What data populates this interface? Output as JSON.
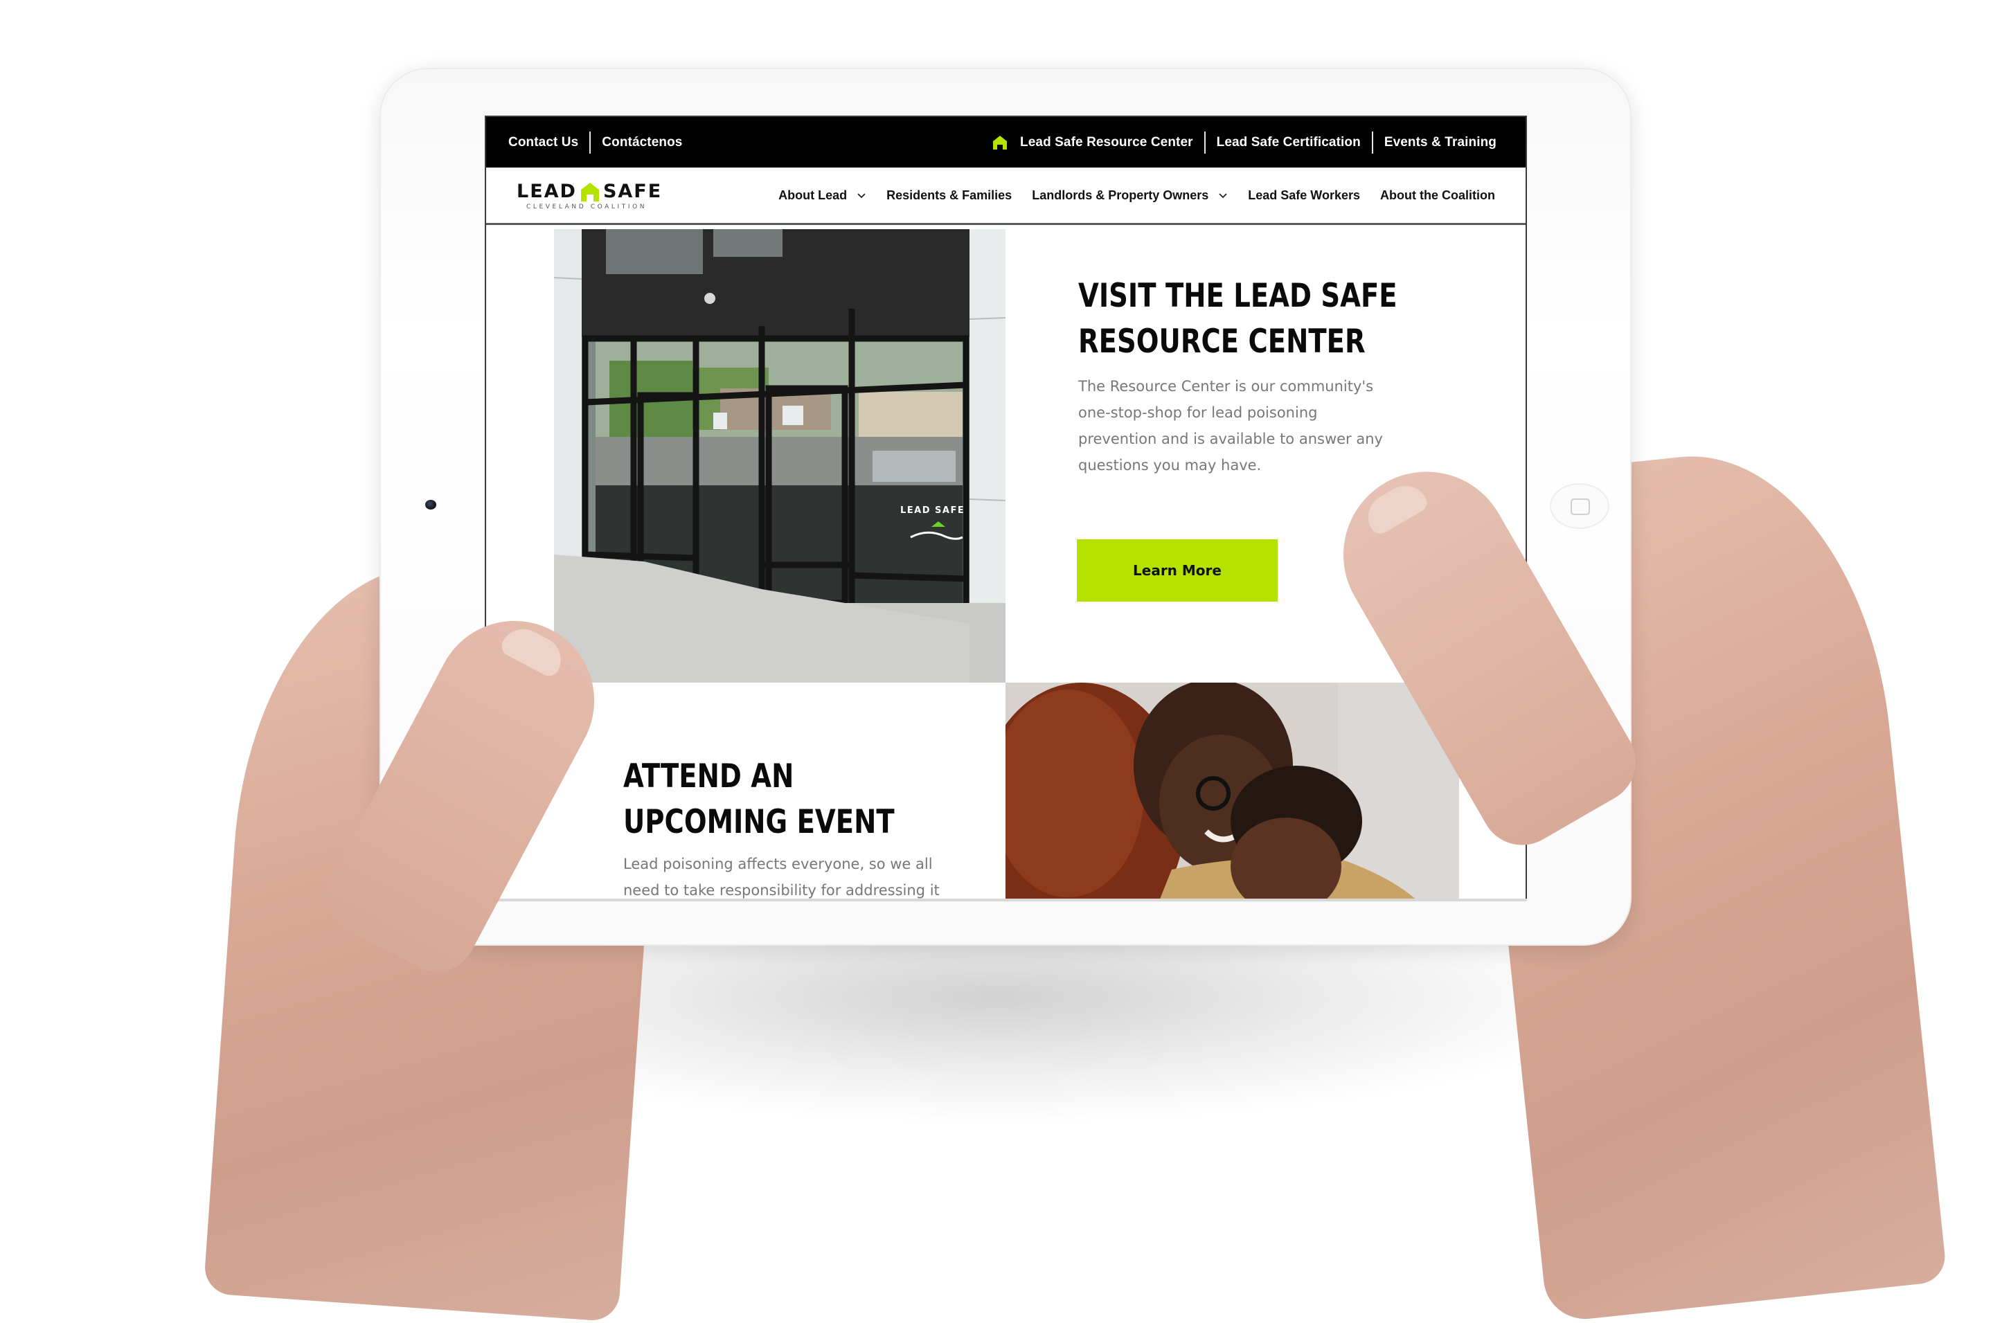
{
  "device": {
    "type": "tablet",
    "camera_icon": "camera-icon",
    "home_button_icon": "home-button-icon"
  },
  "colors": {
    "accent": "#b6e200",
    "topbar_bg": "#000000",
    "heading": "#0a0a0a",
    "body_text": "#777777"
  },
  "topbar": {
    "left_links": [
      "Contact Us",
      "Contáctenos"
    ],
    "right_links": [
      {
        "label": "Lead Safe Resource Center",
        "icon": "house-icon"
      },
      {
        "label": "Lead Safe Certification"
      },
      {
        "label": "Events & Training"
      }
    ]
  },
  "logo": {
    "word_left": "LEAD",
    "word_right": "SAFE",
    "subtitle": "CLEVELAND COALITION",
    "icon": "house-icon"
  },
  "nav": {
    "items": [
      {
        "label": "About Lead",
        "has_dropdown": true
      },
      {
        "label": "Residents & Families",
        "has_dropdown": false
      },
      {
        "label": "Landlords & Property Owners",
        "has_dropdown": true
      },
      {
        "label": "Lead Safe Workers",
        "has_dropdown": false
      },
      {
        "label": "About the Coalition",
        "has_dropdown": false
      }
    ]
  },
  "sections": {
    "resource_center": {
      "heading_line1": "VISIT THE LEAD SAFE",
      "heading_line2": "RESOURCE CENTER",
      "body": "The Resource Center is our community's one-stop-shop for lead poisoning prevention and is available to answer any questions you may have.",
      "button_label": "Learn More",
      "image": "storefront-photo",
      "image_sign": "LEAD SAFE"
    },
    "events": {
      "heading_line1": "ATTEND AN",
      "heading_line2": "UPCOMING EVENT",
      "body": "Lead poisoning affects everyone, so we all need to take responsibility for addressing it",
      "image": "family-photo"
    }
  }
}
